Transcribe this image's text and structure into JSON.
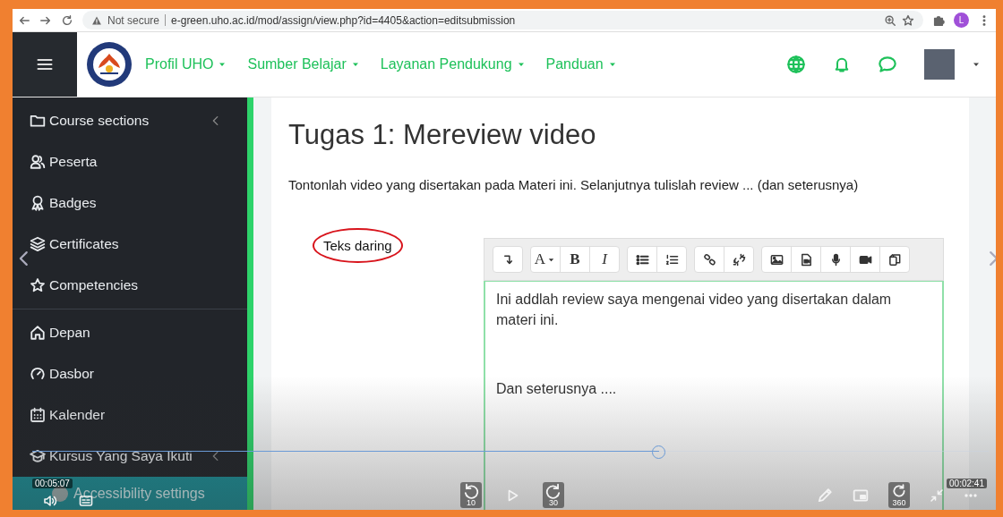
{
  "browser": {
    "security": "Not secure",
    "url": "e-green.uho.ac.id/mod/assign/view.php?id=4405&action=editsubmission",
    "profile_initial": "L"
  },
  "header": {
    "nav": [
      {
        "label": "Profil UHO"
      },
      {
        "label": "Sumber Belajar"
      },
      {
        "label": "Layanan Pendukung"
      },
      {
        "label": "Panduan"
      }
    ]
  },
  "sidebar": {
    "groups": [
      [
        {
          "label": "Course sections",
          "submenu": true
        },
        {
          "label": "Peserta",
          "submenu": false
        },
        {
          "label": "Badges",
          "submenu": false
        },
        {
          "label": "Certificates",
          "submenu": false
        },
        {
          "label": "Competencies",
          "submenu": false
        }
      ],
      [
        {
          "label": "Depan",
          "submenu": false
        },
        {
          "label": "Dasbor",
          "submenu": false
        },
        {
          "label": "Kalender",
          "submenu": false
        },
        {
          "label": "Kursus Yang Saya Ikuti",
          "submenu": true
        }
      ]
    ],
    "accessibility": "Accessibility settings"
  },
  "assignment": {
    "title": "Tugas 1: Mereview video",
    "description": "Tontonlah video yang disertakan pada Materi ini. Selanjutnya tulislah review ... (dan seterusnya)",
    "field_label": "Teks daring",
    "field_label_circled": true,
    "toolbar": [
      [
        {
          "kind": "icon"
        }
      ],
      [
        {
          "kind": "text",
          "label": "A"
        },
        {
          "kind": "text",
          "label": "B"
        },
        {
          "kind": "text",
          "label": "I"
        }
      ],
      [
        {
          "kind": "icon"
        },
        {
          "kind": "icon"
        }
      ],
      [
        {
          "kind": "icon"
        },
        {
          "kind": "icon"
        }
      ],
      [
        {
          "kind": "icon"
        },
        {
          "kind": "icon"
        },
        {
          "kind": "icon"
        },
        {
          "kind": "icon"
        },
        {
          "kind": "icon"
        }
      ]
    ],
    "paragraphs": [
      "Ini addlah review saya mengenai video yang disertakan dalam materi ini.",
      "Dan seterusnya ...."
    ]
  },
  "video": {
    "level": 0.655,
    "elapsed": "00:05:07",
    "remaining": "00:02:41",
    "rewind": "10",
    "forward": "30",
    "view_360": "360"
  }
}
